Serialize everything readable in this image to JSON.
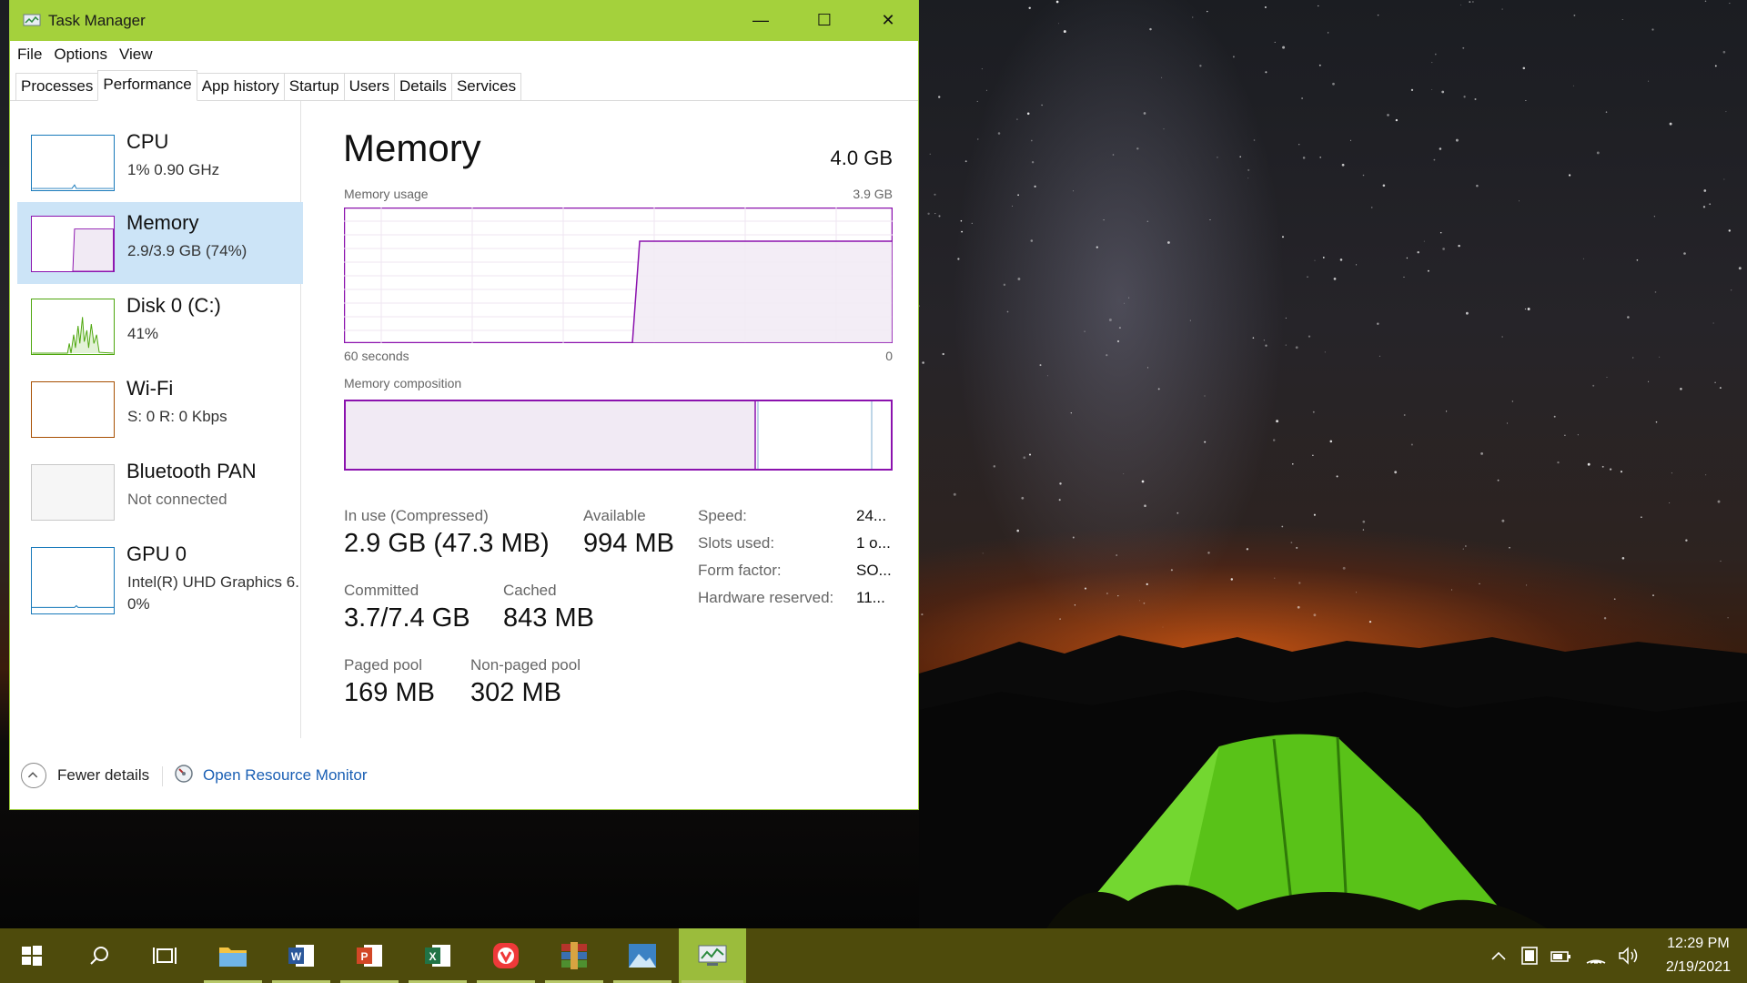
{
  "window": {
    "title": "Task Manager",
    "controls": {
      "minimize": "—",
      "maximize": "☐",
      "close": "✕"
    }
  },
  "menu": [
    "File",
    "Options",
    "View"
  ],
  "tabs": [
    "Processes",
    "Performance",
    "App history",
    "Startup",
    "Users",
    "Details",
    "Services"
  ],
  "active_tab": "Performance",
  "sidebar": {
    "items": [
      {
        "name": "CPU",
        "sub": "1%  0.90 GHz",
        "sub2": "",
        "color": "#1779ba"
      },
      {
        "name": "Memory",
        "sub": "2.9/3.9 GB (74%)",
        "sub2": "",
        "color": "#8b12ae",
        "selected": true
      },
      {
        "name": "Disk 0 (C:)",
        "sub": "41%",
        "sub2": "",
        "color": "#4da60c"
      },
      {
        "name": "Wi-Fi",
        "sub": "S: 0  R: 0 Kbps",
        "sub2": "",
        "color": "#a74f01"
      },
      {
        "name": "Bluetooth PAN",
        "sub": "Not connected",
        "sub2": "",
        "color": "#a0a0a0"
      },
      {
        "name": "GPU 0",
        "sub": "Intel(R) UHD Graphics 6...",
        "sub2": "0%",
        "color": "#1779ba"
      }
    ]
  },
  "memory": {
    "title": "Memory",
    "total": "4.0 GB",
    "usage_label": "Memory usage",
    "usage_max": "3.9 GB",
    "axis_left": "60 seconds",
    "axis_right": "0",
    "composition_label": "Memory composition",
    "usage_fraction": 0.74,
    "color": "#8b12ae",
    "stats": {
      "in_use_label": "In use (Compressed)",
      "in_use_value": "2.9 GB (47.3 MB)",
      "available_label": "Available",
      "available_value": "994 MB",
      "committed_label": "Committed",
      "committed_value": "3.7/7.4 GB",
      "cached_label": "Cached",
      "cached_value": "843 MB",
      "paged_label": "Paged pool",
      "paged_value": "169 MB",
      "nonpaged_label": "Non-paged pool",
      "nonpaged_value": "302 MB"
    },
    "specs": [
      {
        "label": "Speed:",
        "value": "24..."
      },
      {
        "label": "Slots used:",
        "value": "1 o..."
      },
      {
        "label": "Form factor:",
        "value": "SO..."
      },
      {
        "label": "Hardware reserved:",
        "value": "11..."
      }
    ]
  },
  "footer": {
    "fewer_details": "Fewer details",
    "open_resource_monitor": "Open Resource Monitor"
  },
  "taskbar": {
    "icons": [
      "start-icon",
      "search-icon",
      "task-view-icon",
      "file-explorer-icon",
      "word-icon",
      "powerpoint-icon",
      "excel-icon",
      "vivaldi-icon",
      "winrar-icon",
      "photos-icon",
      "task-manager-icon"
    ],
    "time": "12:29 PM",
    "date": "2/19/2021"
  }
}
